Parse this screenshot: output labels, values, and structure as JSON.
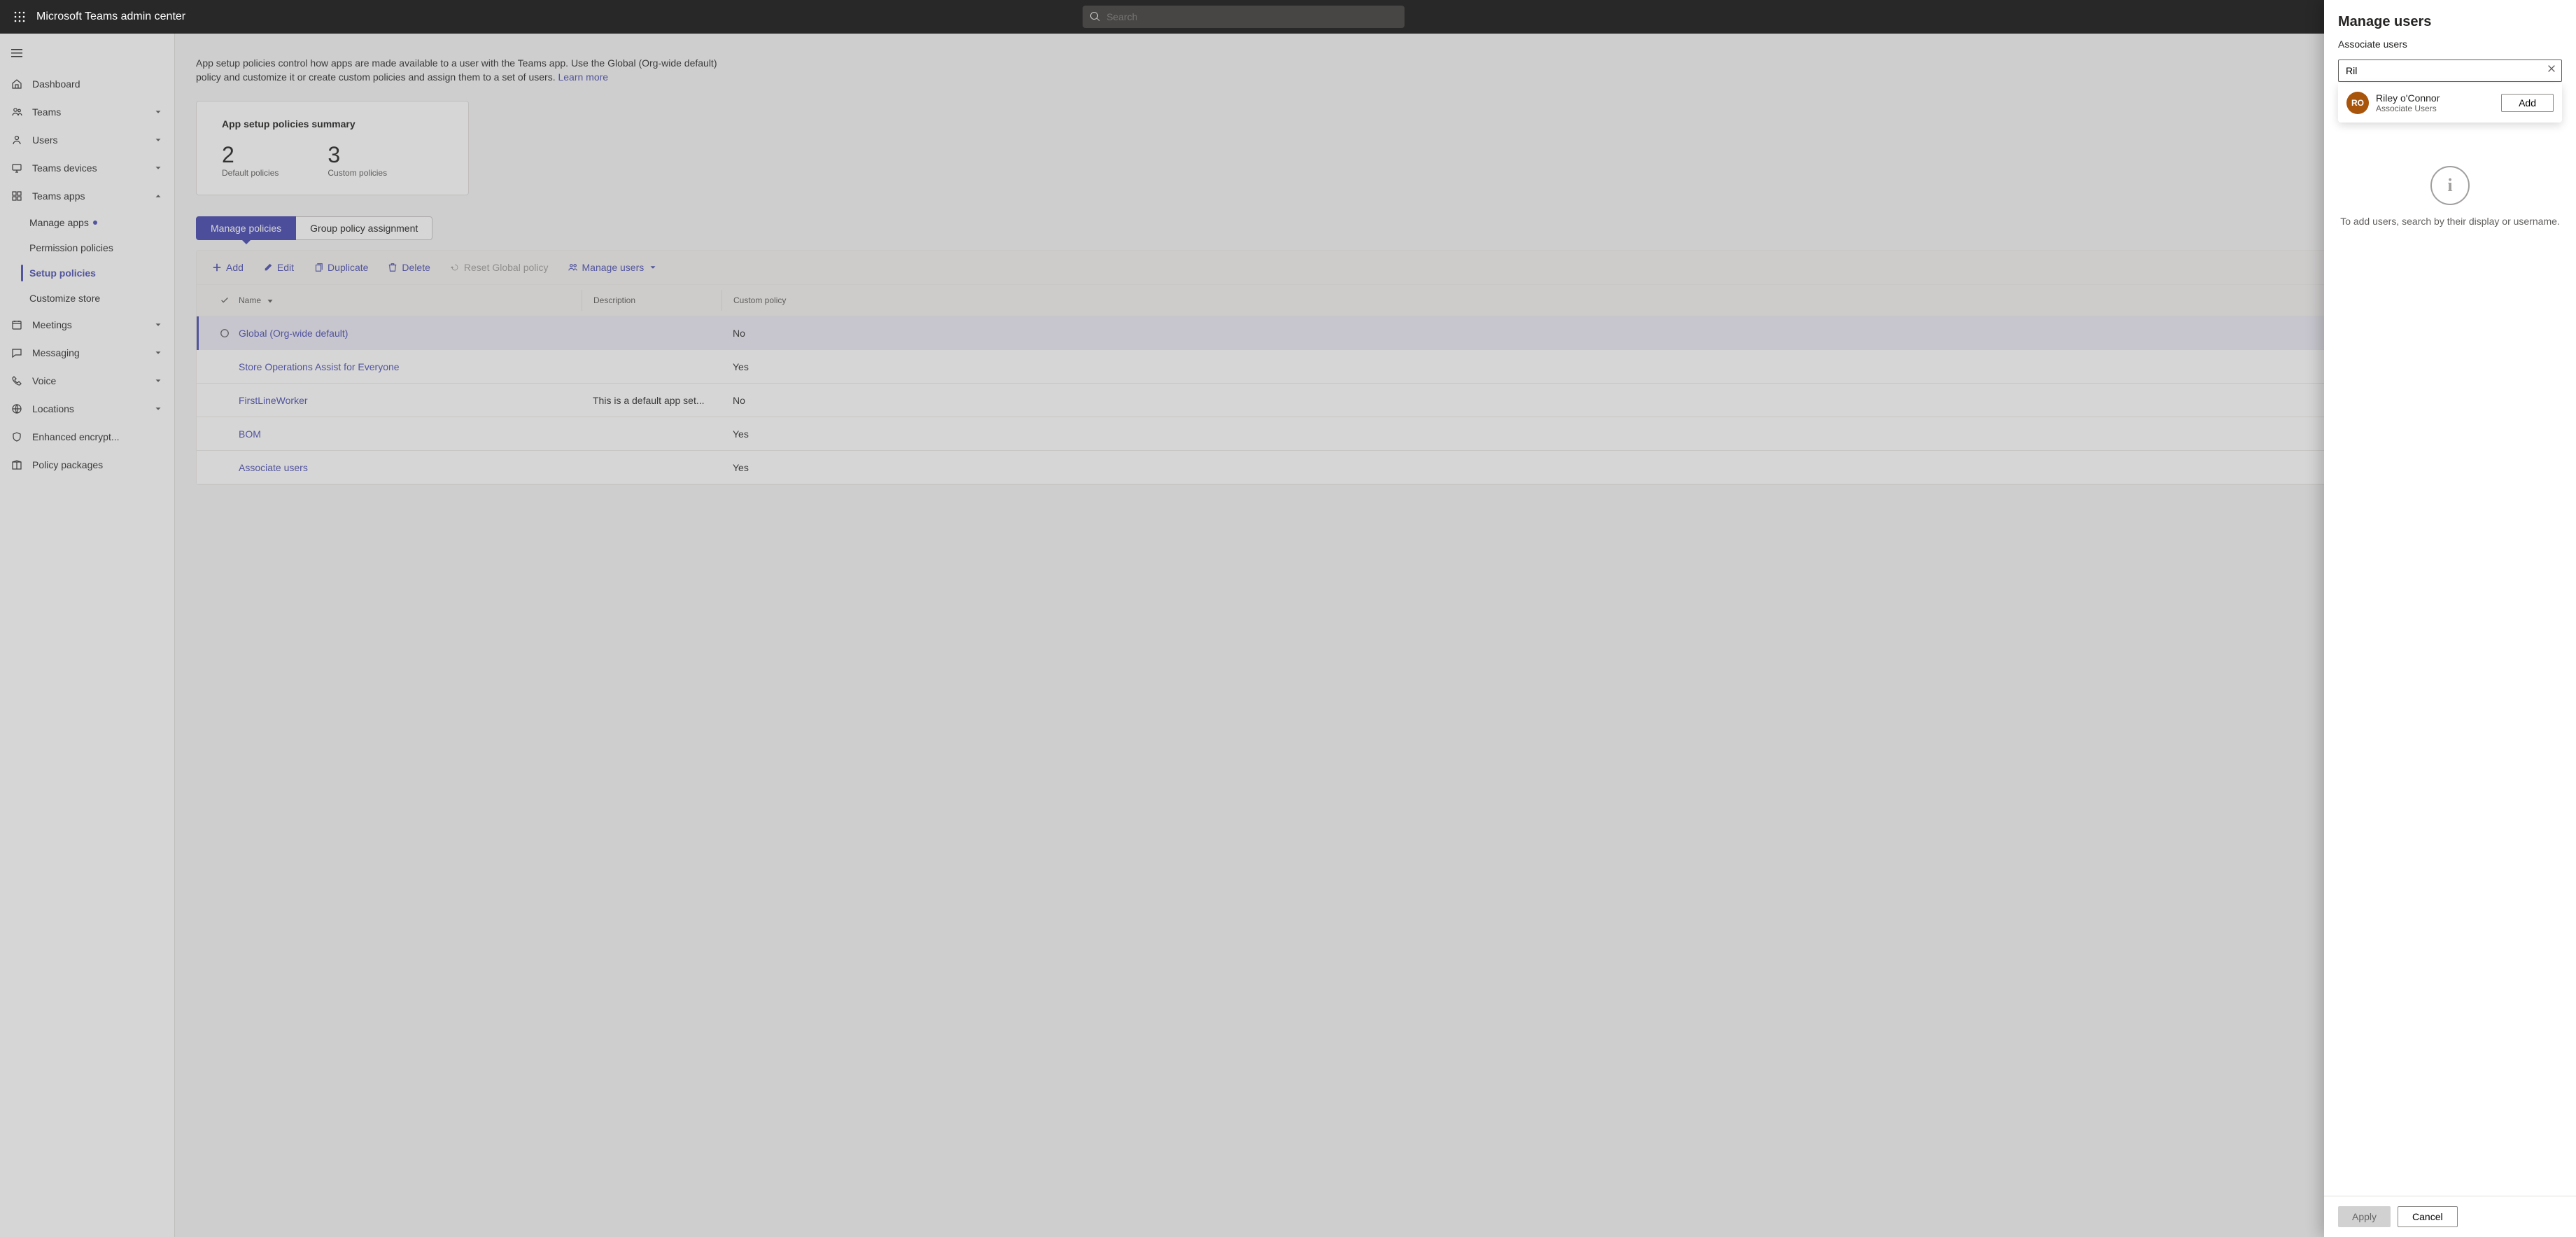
{
  "header": {
    "app_title": "Microsoft Teams admin center",
    "search_placeholder": "Search"
  },
  "sidebar": {
    "items": [
      {
        "label": "Dashboard",
        "expandable": false
      },
      {
        "label": "Teams",
        "expandable": true
      },
      {
        "label": "Users",
        "expandable": true
      },
      {
        "label": "Teams devices",
        "expandable": true
      },
      {
        "label": "Teams apps",
        "expandable": true,
        "expanded": true
      },
      {
        "label": "Meetings",
        "expandable": true
      },
      {
        "label": "Messaging",
        "expandable": true
      },
      {
        "label": "Voice",
        "expandable": true
      },
      {
        "label": "Locations",
        "expandable": true
      },
      {
        "label": "Enhanced encrypt...",
        "expandable": false
      },
      {
        "label": "Policy packages",
        "expandable": false
      }
    ],
    "teams_apps_sub": [
      {
        "label": "Manage apps",
        "dot": true
      },
      {
        "label": "Permission policies"
      },
      {
        "label": "Setup policies",
        "active": true
      },
      {
        "label": "Customize store"
      }
    ]
  },
  "page": {
    "description": "App setup policies control how apps are made available to a user with the Teams app. Use the Global (Org-wide default) policy and customize it or create custom policies and assign them to a set of users.",
    "learn_more": "Learn more",
    "summary": {
      "title": "App setup policies summary",
      "default_count": "2",
      "default_label": "Default policies",
      "custom_count": "3",
      "custom_label": "Custom policies"
    },
    "tabs": {
      "manage": "Manage policies",
      "group": "Group policy assignment"
    },
    "commands": {
      "add": "Add",
      "edit": "Edit",
      "duplicate": "Duplicate",
      "delete": "Delete",
      "reset": "Reset Global policy",
      "manage_users": "Manage users"
    },
    "columns": {
      "name": "Name",
      "description": "Description",
      "custom": "Custom policy"
    },
    "rows": [
      {
        "name": "Global (Org-wide default)",
        "description": "",
        "custom": "No",
        "selected": true
      },
      {
        "name": "Store Operations Assist for Everyone",
        "description": "",
        "custom": "Yes"
      },
      {
        "name": "FirstLineWorker",
        "description": "This is a default app set...",
        "custom": "No"
      },
      {
        "name": "BOM",
        "description": "",
        "custom": "Yes"
      },
      {
        "name": "Associate users",
        "description": "",
        "custom": "Yes"
      }
    ]
  },
  "panel": {
    "title": "Manage users",
    "subtitle": "Associate users",
    "search_value": "Ril",
    "suggestion": {
      "initials": "RO",
      "name": "Riley o'Connor",
      "role": "Associate Users",
      "add": "Add"
    },
    "empty_text": "To add users, search by their display or username.",
    "apply": "Apply",
    "cancel": "Cancel"
  }
}
